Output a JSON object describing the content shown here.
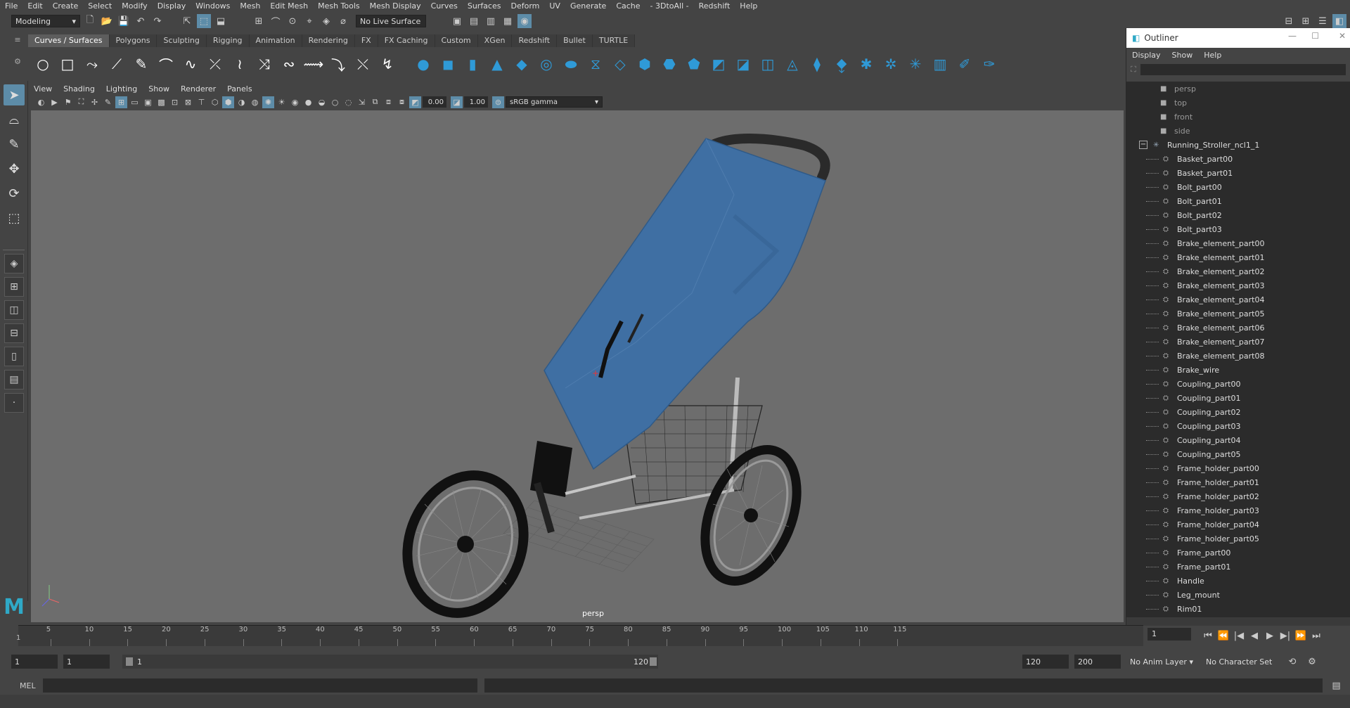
{
  "menubar": {
    "items": [
      "File",
      "Edit",
      "Create",
      "Select",
      "Modify",
      "Display",
      "Windows",
      "Mesh",
      "Edit Mesh",
      "Mesh Tools",
      "Mesh Display",
      "Curves",
      "Surfaces",
      "Deform",
      "UV",
      "Generate",
      "Cache",
      "- 3DtoAll -",
      "Redshift",
      "Help"
    ]
  },
  "status": {
    "mode": "Modeling",
    "live_surface": "No Live Surface"
  },
  "shelf_tabs": [
    "Curves / Surfaces",
    "Polygons",
    "Sculpting",
    "Rigging",
    "Animation",
    "Rendering",
    "FX",
    "FX Caching",
    "Custom",
    "XGen",
    "Redshift",
    "Bullet",
    "TURTLE"
  ],
  "panel_menu": [
    "View",
    "Shading",
    "Lighting",
    "Show",
    "Renderer",
    "Panels"
  ],
  "panel_tools": {
    "exposure": "0.00",
    "gamma": "1.00",
    "color_space": "sRGB gamma"
  },
  "viewport": {
    "camera_label": "persp"
  },
  "outliner": {
    "title": "Outliner",
    "menu": [
      "Display",
      "Show",
      "Help"
    ],
    "cameras": [
      "persp",
      "top",
      "front",
      "side"
    ],
    "group": "Running_Stroller_ncl1_1",
    "children": [
      "Basket_part00",
      "Basket_part01",
      "Bolt_part00",
      "Bolt_part01",
      "Bolt_part02",
      "Bolt_part03",
      "Brake_element_part00",
      "Brake_element_part01",
      "Brake_element_part02",
      "Brake_element_part03",
      "Brake_element_part04",
      "Brake_element_part05",
      "Brake_element_part06",
      "Brake_element_part07",
      "Brake_element_part08",
      "Brake_wire",
      "Coupling_part00",
      "Coupling_part01",
      "Coupling_part02",
      "Coupling_part03",
      "Coupling_part04",
      "Coupling_part05",
      "Frame_holder_part00",
      "Frame_holder_part01",
      "Frame_holder_part02",
      "Frame_holder_part03",
      "Frame_holder_part04",
      "Frame_holder_part05",
      "Frame_part00",
      "Frame_part01",
      "Handle",
      "Leg_mount",
      "Rim01"
    ]
  },
  "timeline": {
    "ticks": [
      "5",
      "10",
      "15",
      "20",
      "25",
      "30",
      "35",
      "40",
      "45",
      "50",
      "55",
      "60",
      "65",
      "70",
      "75",
      "80",
      "85",
      "90",
      "95",
      "100",
      "105",
      "110",
      "115"
    ],
    "current_frame_marker": "1",
    "current_frame": "1"
  },
  "range": {
    "start": "1",
    "playback_start": "1",
    "slider_start": "1",
    "slider_end": "120",
    "playback_end": "120",
    "end": "200",
    "anim_layer": "No Anim Layer",
    "char_set": "No Character Set"
  },
  "cmd": {
    "label": "MEL"
  }
}
